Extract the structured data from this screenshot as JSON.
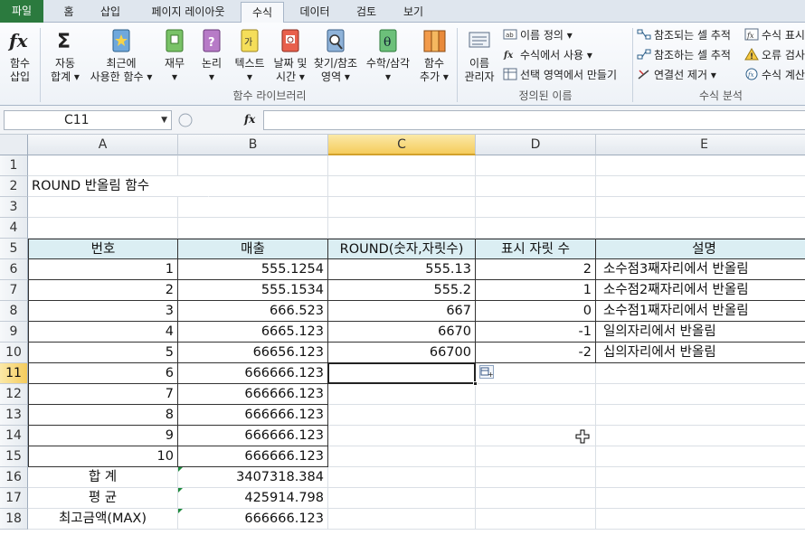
{
  "tabs": [
    {
      "label": "파일"
    },
    {
      "label": "홈"
    },
    {
      "label": "삽입"
    },
    {
      "label": "페이지 레이아웃"
    },
    {
      "label": "수식"
    },
    {
      "label": "데이터"
    },
    {
      "label": "검토"
    },
    {
      "label": "보기"
    }
  ],
  "ribbon": {
    "insert_function": {
      "line1": "함수",
      "line2": "삽입"
    },
    "autosum": {
      "line1": "자동",
      "line2": "합계 ▾"
    },
    "recent": {
      "line1": "최근에",
      "line2": "사용한 함수 ▾"
    },
    "financial": {
      "line1": "재무",
      "line2": "▾"
    },
    "logical": {
      "line1": "논리",
      "line2": "▾"
    },
    "text": {
      "line1": "텍스트",
      "line2": "▾"
    },
    "datetime": {
      "line1": "날짜 및",
      "line2": "시간 ▾"
    },
    "lookup": {
      "line1": "찾기/참조",
      "line2": "영역 ▾"
    },
    "math": {
      "line1": "수학/삼각",
      "line2": "▾"
    },
    "more": {
      "line1": "함수",
      "line2": "추가 ▾"
    },
    "function_library_label": "함수 라이브러리",
    "name_manager": {
      "line1": "이름",
      "line2": "관리자"
    },
    "define_name": "이름 정의 ▾",
    "use_in_formula": "수식에서 사용 ▾",
    "create_from_selection": "선택 영역에서 만들기",
    "defined_names_label": "정의된 이름",
    "trace_precedents": "참조되는 셀 추적",
    "trace_dependents": "참조하는 셀 추적",
    "remove_arrows": "연결선 제거 ▾",
    "show_formulas": "수식 표시",
    "error_checking": "오류 검사",
    "evaluate_formula": "수식 계산",
    "formula_auditing_label": "수식 분석"
  },
  "formula_bar": {
    "name_box": "C11",
    "formula": ""
  },
  "columns": [
    "A",
    "B",
    "C",
    "D",
    "E"
  ],
  "rows": [
    "1",
    "2",
    "3",
    "4",
    "5",
    "6",
    "7",
    "8",
    "9",
    "10",
    "11",
    "12",
    "13",
    "14",
    "15",
    "16",
    "17",
    "18"
  ],
  "sheet": {
    "title": "ROUND 반올림 함수",
    "headers": [
      "번호",
      "매출",
      "ROUND(숫자,자릿수)",
      "표시 자릿 수",
      "설명"
    ],
    "data_rows": [
      {
        "no": "1",
        "sales": "555.1254",
        "round": "555.13",
        "digits": "2",
        "desc": "소수점3째자리에서 반올림"
      },
      {
        "no": "2",
        "sales": "555.1534",
        "round": "555.2",
        "digits": "1",
        "desc": "소수점2째자리에서 반올림"
      },
      {
        "no": "3",
        "sales": "666.523",
        "round": "667",
        "digits": "0",
        "desc": "소수점1째자리에서 반올림"
      },
      {
        "no": "4",
        "sales": "6665.123",
        "round": "6670",
        "digits": "-1",
        "desc": "일의자리에서 반올림"
      },
      {
        "no": "5",
        "sales": "66656.123",
        "round": "66700",
        "digits": "-2",
        "desc": "십의자리에서 반올림"
      },
      {
        "no": "6",
        "sales": "666666.123",
        "round": "",
        "digits": "",
        "desc": ""
      },
      {
        "no": "7",
        "sales": "666666.123",
        "round": "",
        "digits": "",
        "desc": ""
      },
      {
        "no": "8",
        "sales": "666666.123",
        "round": "",
        "digits": "",
        "desc": ""
      },
      {
        "no": "9",
        "sales": "666666.123",
        "round": "",
        "digits": "",
        "desc": ""
      },
      {
        "no": "10",
        "sales": "666666.123",
        "round": "",
        "digits": "",
        "desc": ""
      }
    ],
    "summary": [
      {
        "label": "합 계",
        "value": "3407318.384"
      },
      {
        "label": "평 균",
        "value": "425914.798"
      },
      {
        "label": "최고금액(MAX)",
        "value": "666666.123"
      }
    ]
  },
  "colors": {
    "file_tab": "#2b7a3e",
    "header_fill": "#dbeef3",
    "selection": "#f5cc5c"
  }
}
